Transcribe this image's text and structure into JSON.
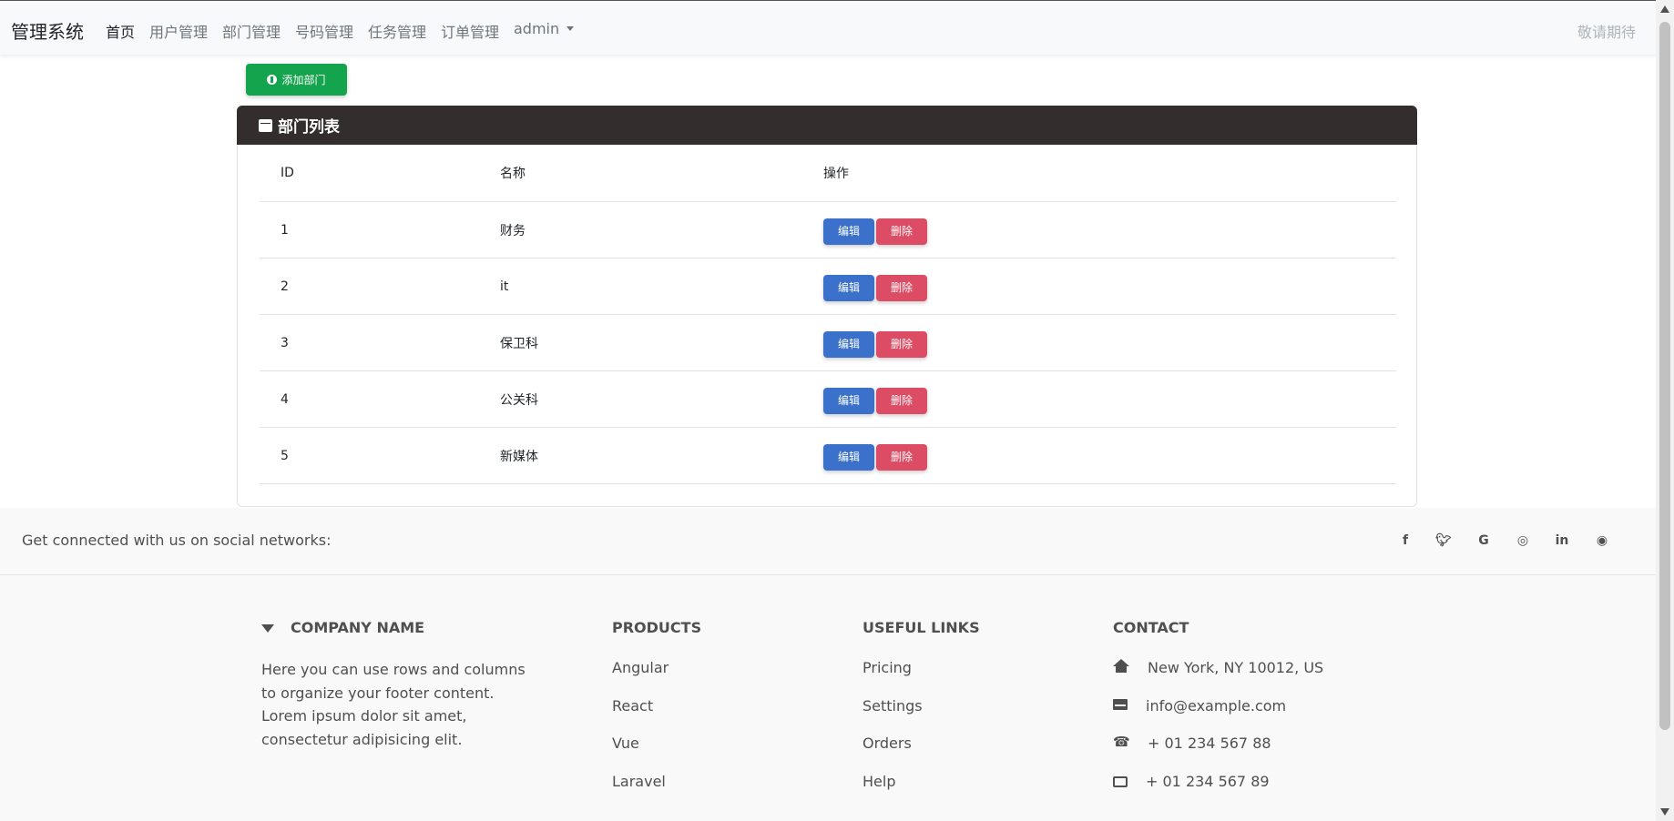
{
  "navbar": {
    "brand": "管理系统",
    "items": [
      {
        "label": "首页"
      },
      {
        "label": "用户管理"
      },
      {
        "label": "部门管理"
      },
      {
        "label": "号码管理"
      },
      {
        "label": "任务管理"
      },
      {
        "label": "订单管理"
      },
      {
        "label": "admin"
      }
    ],
    "right_text": "敬请期待"
  },
  "add_button": {
    "label": "添加部门"
  },
  "card": {
    "title": "部门列表",
    "columns": [
      "ID",
      "名称",
      "操作"
    ],
    "rows": [
      {
        "id": "1",
        "name": "财务"
      },
      {
        "id": "2",
        "name": "it"
      },
      {
        "id": "3",
        "name": "保卫科"
      },
      {
        "id": "4",
        "name": "公关科"
      },
      {
        "id": "5",
        "name": "新媒体"
      }
    ],
    "edit_label": "编辑",
    "delete_label": "删除"
  },
  "footer": {
    "social_text": "Get connected with us on social networks:",
    "social_icons": [
      "facebook-icon",
      "twitter-icon",
      "google-icon",
      "instagram-icon",
      "linkedin-icon",
      "github-icon"
    ],
    "company": {
      "title": "Company name",
      "text": "Here you can use rows and columns to organize your footer content. Lorem ipsum dolor sit amet, consectetur adipisicing elit."
    },
    "products": {
      "title": "Products",
      "links": [
        "Angular",
        "React",
        "Vue",
        "Laravel"
      ]
    },
    "useful_links": {
      "title": "Useful links",
      "links": [
        "Pricing",
        "Settings",
        "Orders",
        "Help"
      ]
    },
    "contact": {
      "title": "Contact",
      "address": "New York, NY 10012, US",
      "email": "info@example.com",
      "phone": "+ 01 234 567 88",
      "fax": "+ 01 234 567 89"
    }
  },
  "colors": {
    "success": "#14a44d",
    "primary": "#3b71ca",
    "danger": "#dc4c64",
    "card_header": "#332d2d"
  }
}
